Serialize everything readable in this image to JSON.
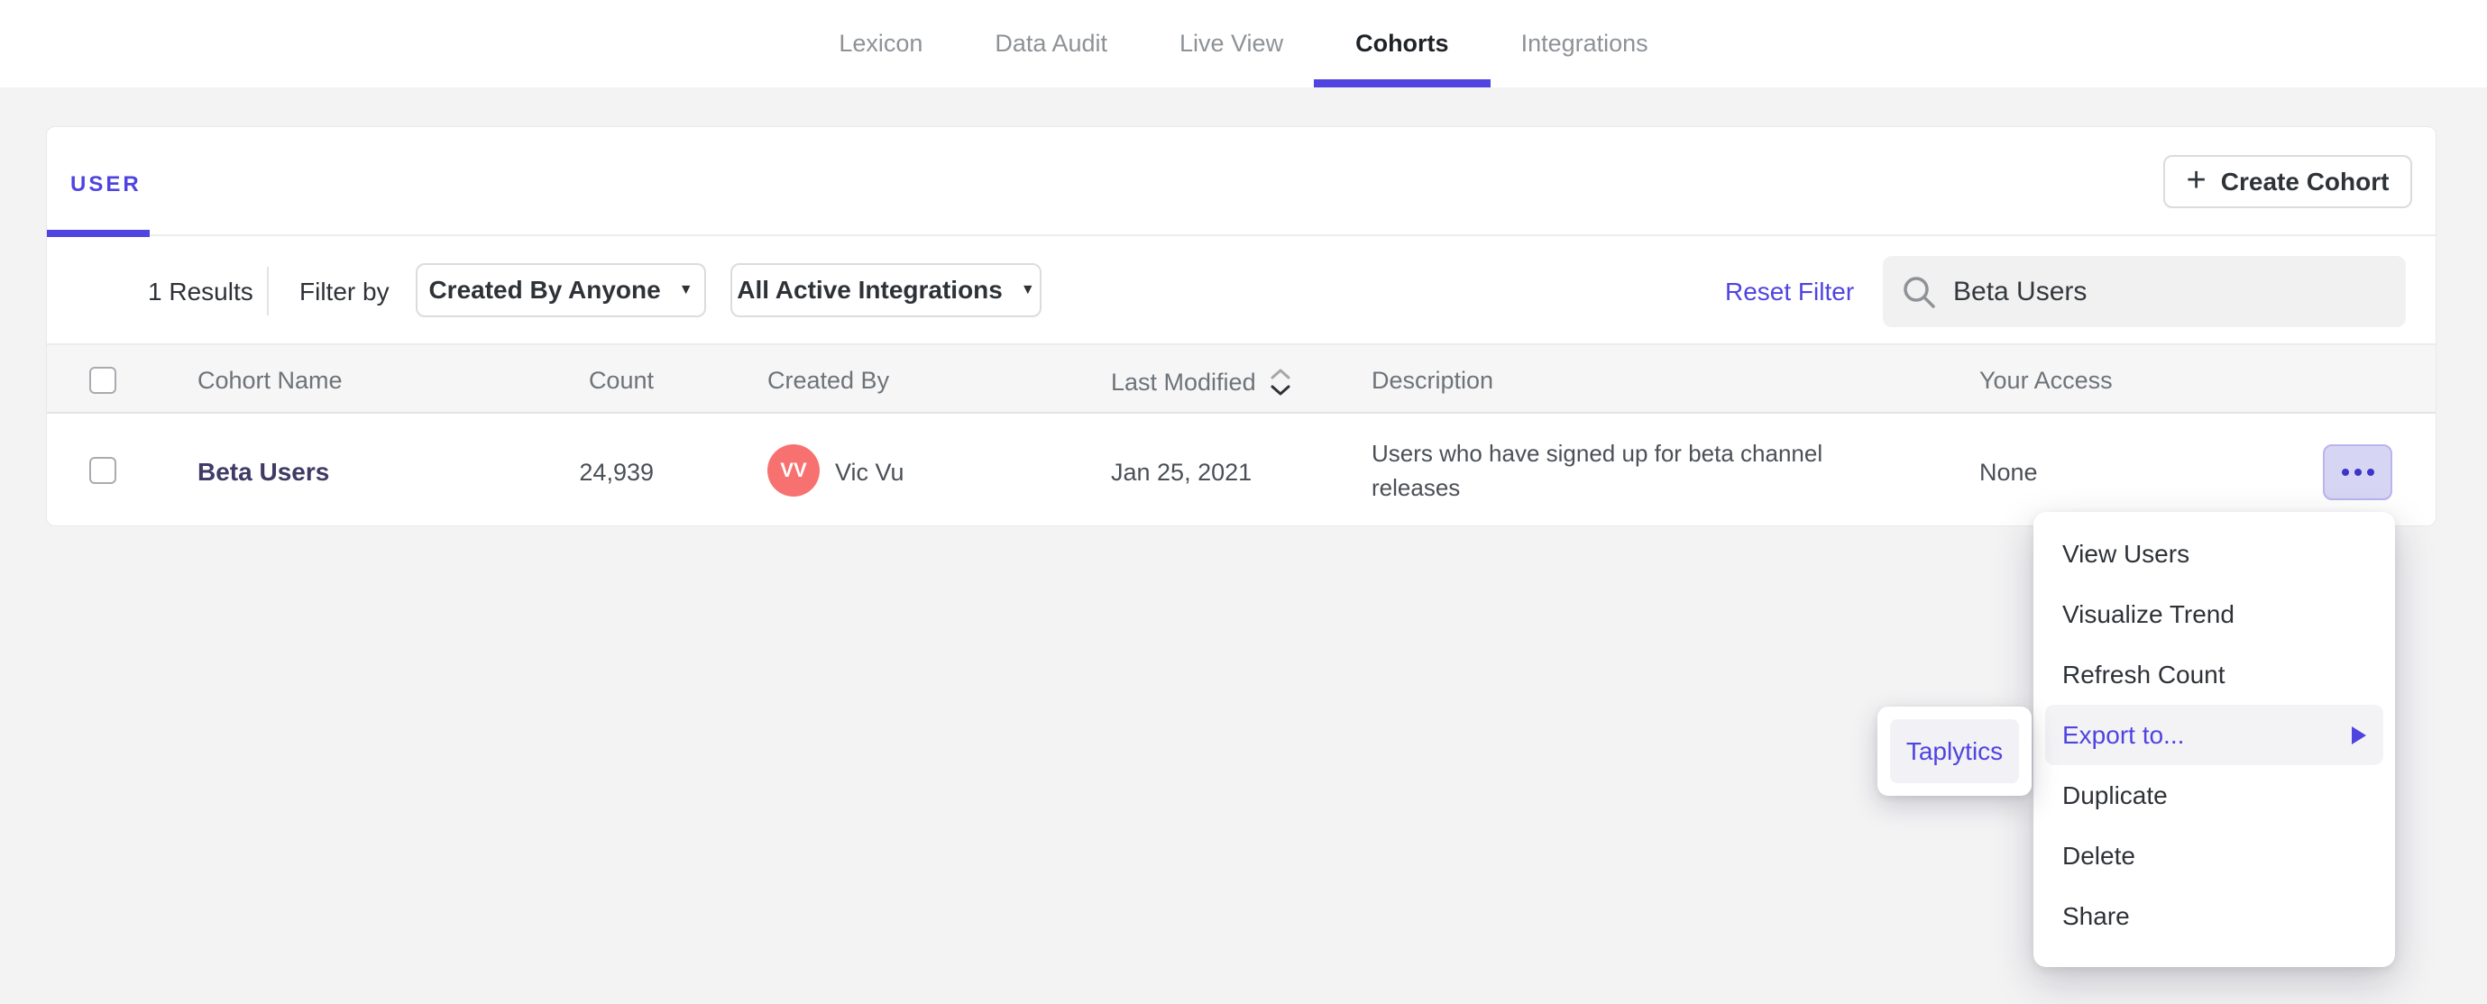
{
  "colors": {
    "accent": "#4f44e0",
    "avatar_bg": "#f87171",
    "actions_button_bg": "#d7d5f4",
    "actions_button_border": "#b9b5ec",
    "menu_highlight_bg": "#f3f3f6"
  },
  "nav": {
    "tabs": [
      {
        "label": "Lexicon",
        "active": false
      },
      {
        "label": "Data Audit",
        "active": false
      },
      {
        "label": "Live View",
        "active": false
      },
      {
        "label": "Cohorts",
        "active": true
      },
      {
        "label": "Integrations",
        "active": false
      }
    ]
  },
  "panel": {
    "tab_label": "USER",
    "create_cohort_label": "Create Cohort",
    "filters": {
      "results_count": "1 Results",
      "filter_by_label": "Filter by",
      "created_by_dropdown": "Created By Anyone",
      "integrations_dropdown": "All Active Integrations",
      "reset_filter_label": "Reset Filter"
    },
    "search": {
      "value": "Beta Users"
    },
    "table": {
      "headers": {
        "cohort_name": "Cohort Name",
        "count": "Count",
        "created_by": "Created By",
        "last_modified": "Last Modified",
        "description": "Description",
        "your_access": "Your Access"
      },
      "row": {
        "name": "Beta Users",
        "count": "24,939",
        "avatar_initials": "VV",
        "created_by": "Vic Vu",
        "last_modified": "Jan 25, 2021",
        "description": "Users who have signed up for beta channel releases",
        "access": "None"
      }
    }
  },
  "context_menu": {
    "items": [
      "View Users",
      "Visualize Trend",
      "Refresh Count",
      "Export to...",
      "Duplicate",
      "Delete",
      "Share"
    ],
    "highlighted_item": "Export to...",
    "submenu": {
      "items": [
        "Taplytics"
      ]
    }
  }
}
